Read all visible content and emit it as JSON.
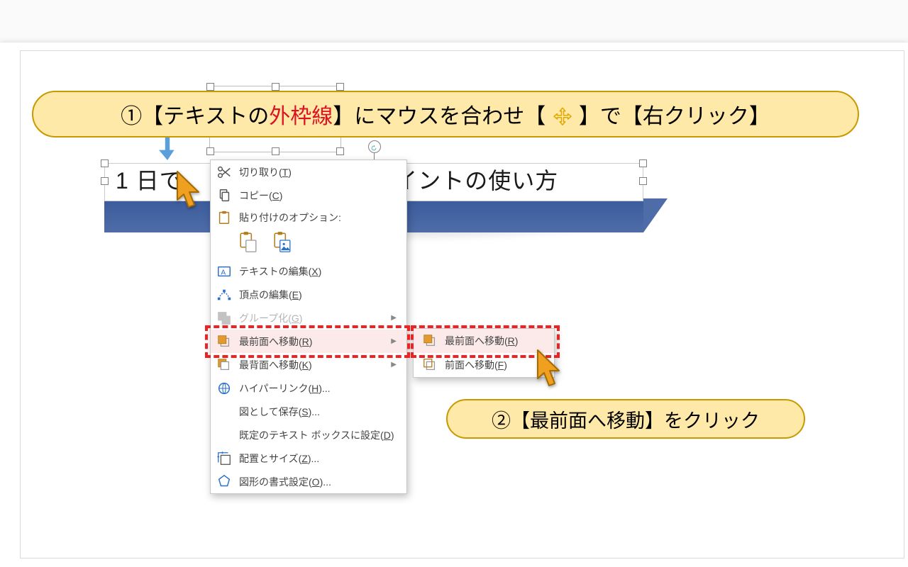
{
  "callout1": {
    "left": "①【テキストの",
    "outline": "外枠線",
    "middle": "】にマウスを合わせ【 ",
    "right": " 】で【右クリック】"
  },
  "callout2": {
    "text": "②【最前面へ移動】をクリック"
  },
  "titlebox": {
    "left_text": "1 日で",
    "right_text": "ポイントの使い方"
  },
  "menu": {
    "cut": {
      "label": "切り取り(",
      "u": "T",
      "tail": ")"
    },
    "copy": {
      "label": "コピー(",
      "u": "C",
      "tail": ")"
    },
    "paste_label": "貼り付けのオプション:",
    "edit_text": {
      "label": "テキストの編集(",
      "u": "X",
      "tail": ")"
    },
    "edit_pts": {
      "label": "頂点の編集(",
      "u": "E",
      "tail": ")"
    },
    "group": {
      "label": "グループ化(",
      "u": "G",
      "tail": ")"
    },
    "bring_front": {
      "label": "最前面へ移動(",
      "u": "R",
      "tail": ")"
    },
    "send_back": {
      "label": "最背面へ移動(",
      "u": "K",
      "tail": ")"
    },
    "hyperlink": {
      "label": "ハイパーリンク(",
      "u": "H",
      "tail": ")..."
    },
    "save_img": {
      "label": "図として保存(",
      "u": "S",
      "tail": ")..."
    },
    "default_tb": {
      "label": "既定のテキスト ボックスに設定(",
      "u": "D",
      "tail": ")"
    },
    "size_pos": {
      "label": "配置とサイズ(",
      "u": "Z",
      "tail": ")..."
    },
    "format_shape": {
      "label": "図形の書式設定(",
      "u": "O",
      "tail": ")..."
    }
  },
  "submenu": {
    "bring_front": {
      "label": "最前面へ移動(",
      "u": "R",
      "tail": ")"
    },
    "bring_fwd": {
      "label": "前面へ移動(",
      "u": "F",
      "tail": ")"
    }
  }
}
